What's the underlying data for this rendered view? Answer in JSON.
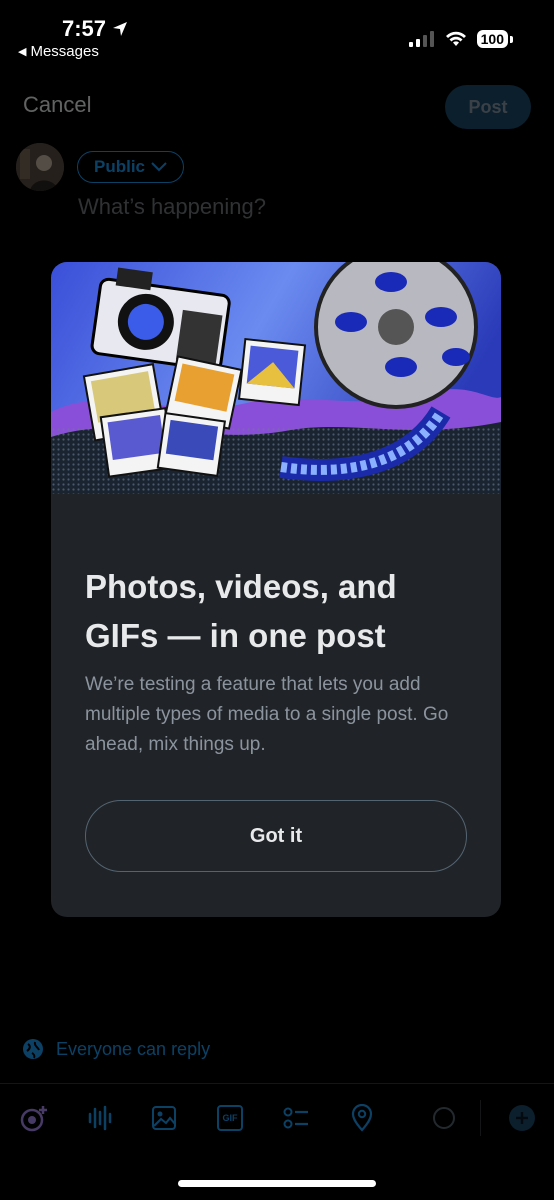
{
  "status_bar": {
    "time": "7:57",
    "back_label": "Messages",
    "battery": "100"
  },
  "compose": {
    "cancel_label": "Cancel",
    "post_label": "Post",
    "audience_label": "Public",
    "placeholder": "What’s happening?"
  },
  "modal": {
    "title": "Photos, videos, and GIFs — in one post",
    "description": "We’re testing a feature that lets you add multiple types of media to a single post. Go ahead, mix things up.",
    "button_label": "Got it"
  },
  "reply_setting": {
    "label": "Everyone can reply"
  },
  "toolbar": {
    "items": [
      "spaces-icon",
      "audio-icon",
      "image-icon",
      "gif-icon",
      "poll-icon",
      "location-icon",
      "char-counter-ring",
      "add-post-icon"
    ],
    "gif_label": "GIF"
  },
  "colors": {
    "accent": "#1d9bf0",
    "card_bg": "#202327",
    "page_bg": "#000000"
  }
}
